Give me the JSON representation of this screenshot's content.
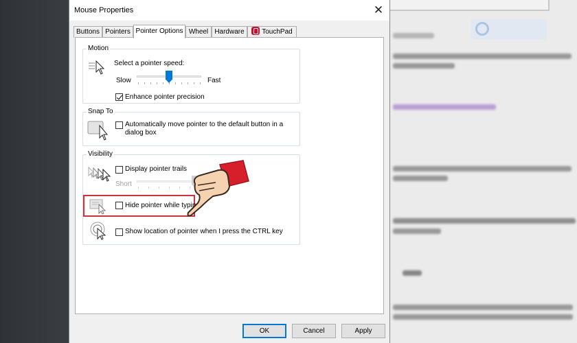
{
  "window": {
    "title": "Mouse Properties",
    "close_glyph": "✕"
  },
  "tabs": [
    {
      "label": "Buttons"
    },
    {
      "label": "Pointers"
    },
    {
      "label": "Pointer Options",
      "active": true
    },
    {
      "label": "Wheel"
    },
    {
      "label": "Hardware"
    },
    {
      "label": "TouchPad",
      "icon": "touchpad-icon"
    }
  ],
  "motion": {
    "group_label": "Motion",
    "speed_label": "Select a pointer speed:",
    "slow_label": "Slow",
    "fast_label": "Fast",
    "speed_value": 0.5,
    "precision_label": "Enhance pointer precision",
    "precision_checked": true
  },
  "snap": {
    "group_label": "Snap To",
    "auto_label_line1": "Automatically move pointer to the default button in a",
    "auto_label_line2": "dialog box",
    "auto_checked": false
  },
  "visibility": {
    "group_label": "Visibility",
    "trails_label": "Display pointer trails",
    "trails_checked": false,
    "short_label": "Short",
    "hide_label": "Hide pointer while typing",
    "hide_checked": false,
    "show_label": "Show location of pointer when I press the CTRL key",
    "show_checked": false
  },
  "footer": {
    "ok_label": "OK",
    "cancel_label": "Cancel",
    "apply_label": "Apply"
  },
  "colors": {
    "accent": "#0078d7",
    "highlight": "#d0303a",
    "touchpad_brand": "#c8102e"
  }
}
